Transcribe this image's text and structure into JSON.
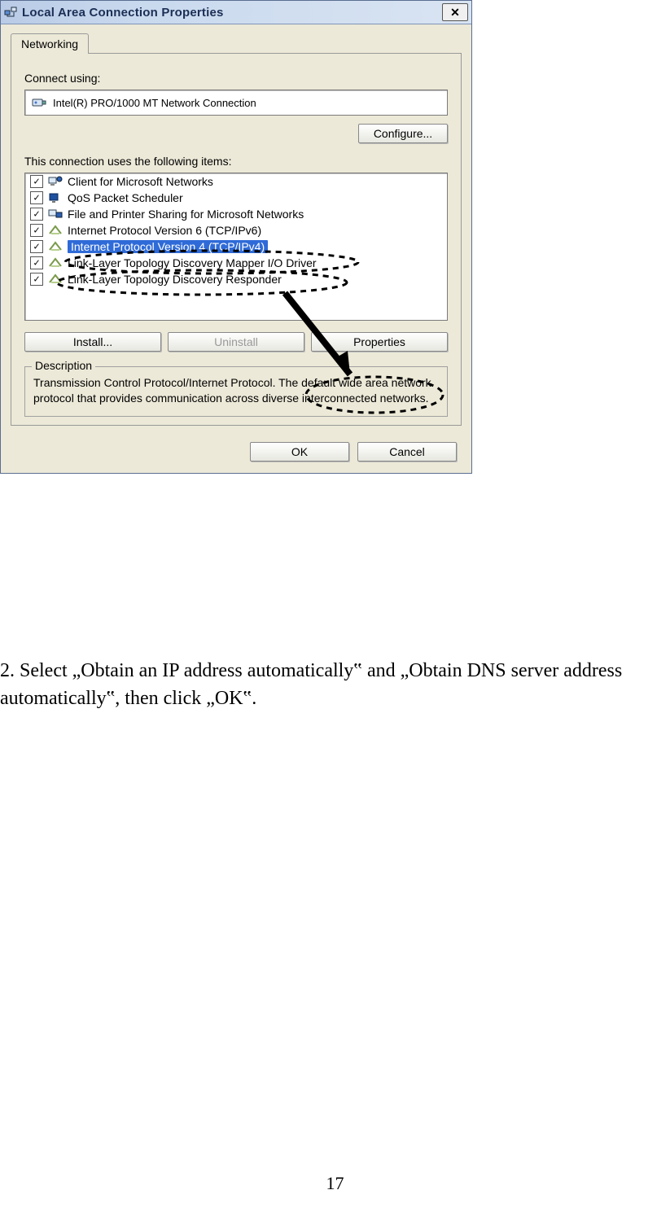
{
  "dialog": {
    "title": "Local Area Connection Properties",
    "tab": "Networking",
    "connect_label": "Connect using:",
    "adapter": "Intel(R) PRO/1000 MT Network Connection",
    "configure": "Configure...",
    "items_label": "This connection uses the following items:",
    "items": [
      "Client for Microsoft Networks",
      "QoS Packet Scheduler",
      "File and Printer Sharing for Microsoft Networks",
      "Internet Protocol Version 6 (TCP/IPv6)",
      "Internet Protocol Version 4 (TCP/IPv4)",
      "Link-Layer Topology Discovery Mapper I/O Driver",
      "Link-Layer Topology Discovery Responder"
    ],
    "install": "Install...",
    "uninstall": "Uninstall",
    "properties": "Properties",
    "desc_title": "Description",
    "desc_text": "Transmission Control Protocol/Internet Protocol. The default wide area network protocol that provides communication across diverse interconnected networks.",
    "ok": "OK",
    "cancel": "Cancel"
  },
  "instruction": "2. Select „Obtain an IP address automatically‟ and „Obtain DNS server address automatically‟, then click „OK‟.",
  "page_number": "17"
}
